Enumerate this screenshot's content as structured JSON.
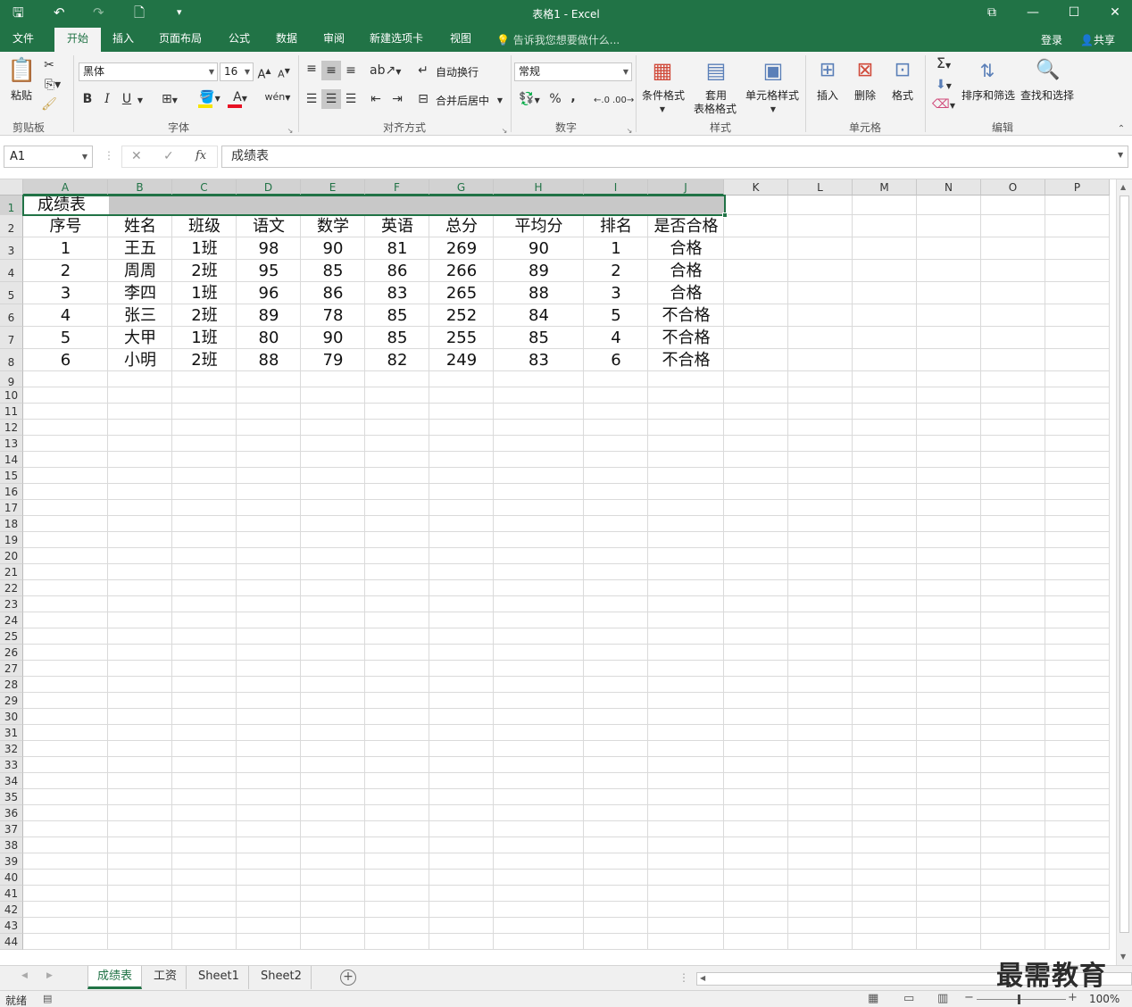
{
  "window": {
    "title": "表格1 - Excel",
    "controls": [
      "⧉",
      "—",
      "☐",
      "✕"
    ]
  },
  "quick_access": {
    "save": "🖫",
    "undo": "↶",
    "redo": "↷",
    "new": "🗋",
    "customize": "▾"
  },
  "menu": {
    "tabs": [
      "文件",
      "开始",
      "插入",
      "页面布局",
      "公式",
      "数据",
      "审阅",
      "新建选项卡",
      "视图"
    ],
    "active": "开始",
    "tell_me": "告诉我您想要做什么...",
    "login": "登录",
    "share": "共享"
  },
  "ribbon": {
    "clipboard": {
      "paste": "粘贴",
      "label": "剪贴板"
    },
    "font": {
      "name": "黑体",
      "size": "16",
      "bold": "B",
      "italic": "I",
      "underline": "U",
      "label": "字体"
    },
    "alignment": {
      "wrap": "自动换行",
      "merge": "合并后居中",
      "label": "对齐方式"
    },
    "number": {
      "format": "常规",
      "percent": "%",
      "comma": ",",
      "label": "数字"
    },
    "styles": {
      "conditional": "条件格式",
      "table_a": "套用",
      "table_b": "表格格式",
      "cell_styles": "单元格样式",
      "label": "样式"
    },
    "cells": {
      "insert": "插入",
      "delete": "删除",
      "format": "格式",
      "label": "单元格"
    },
    "editing": {
      "sort": "排序和筛选",
      "find": "查找和选择",
      "label": "编辑"
    }
  },
  "formula_bar": {
    "name_box": "A1",
    "fx": "fx",
    "content": "成绩表"
  },
  "columns": [
    "A",
    "B",
    "C",
    "D",
    "E",
    "F",
    "G",
    "H",
    "I",
    "J",
    "K",
    "L",
    "M",
    "N",
    "O",
    "P"
  ],
  "rows": [
    "1",
    "2",
    "3",
    "4",
    "5",
    "6",
    "7",
    "8",
    "9",
    "10",
    "11",
    "12",
    "13",
    "14",
    "15",
    "16",
    "17",
    "18",
    "19",
    "20",
    "21",
    "22",
    "23",
    "24",
    "25",
    "26",
    "27",
    "28",
    "29",
    "30",
    "31",
    "32",
    "33",
    "34",
    "35",
    "36",
    "37",
    "38",
    "39",
    "40",
    "41",
    "42",
    "43",
    "44"
  ],
  "sheet": {
    "title": "成绩表",
    "headers": [
      "序号",
      "姓名",
      "班级",
      "语文",
      "数学",
      "英语",
      "总分",
      "平均分",
      "排名",
      "是否合格"
    ],
    "data": [
      [
        "1",
        "王五",
        "1班",
        "98",
        "90",
        "81",
        "269",
        "90",
        "1",
        "合格"
      ],
      [
        "2",
        "周周",
        "2班",
        "95",
        "85",
        "86",
        "266",
        "89",
        "2",
        "合格"
      ],
      [
        "3",
        "李四",
        "1班",
        "96",
        "86",
        "83",
        "265",
        "88",
        "3",
        "合格"
      ],
      [
        "4",
        "张三",
        "2班",
        "89",
        "78",
        "85",
        "252",
        "84",
        "5",
        "不合格"
      ],
      [
        "5",
        "大甲",
        "1班",
        "80",
        "90",
        "85",
        "255",
        "85",
        "4",
        "不合格"
      ],
      [
        "6",
        "小明",
        "2班",
        "88",
        "79",
        "82",
        "249",
        "83",
        "6",
        "不合格"
      ]
    ]
  },
  "sheet_tabs": [
    "成绩表",
    "工资",
    "Sheet1",
    "Sheet2"
  ],
  "active_sheet": "成绩表",
  "status": {
    "ready": "就绪",
    "zoom": "100%"
  },
  "watermark": "最需教育"
}
